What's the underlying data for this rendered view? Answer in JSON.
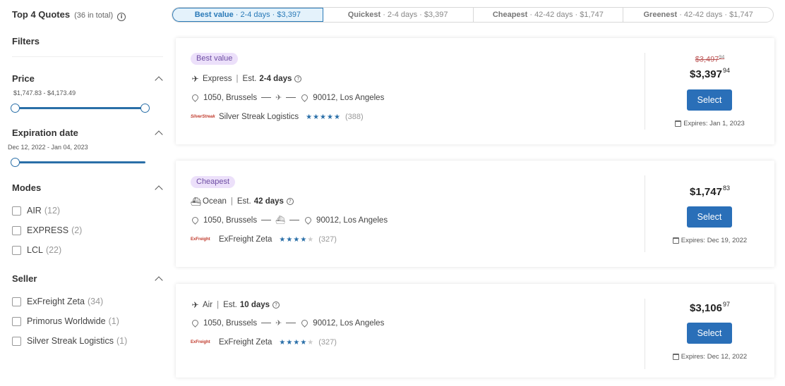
{
  "header": {
    "title": "Top 4 Quotes",
    "count": "(36 in total)"
  },
  "sort_tabs": [
    {
      "label": "Best value",
      "detail": "· 2-4 days · $3,397"
    },
    {
      "label": "Quickest",
      "detail": "· 2-4 days · $3,397"
    },
    {
      "label": "Cheapest",
      "detail": "· 42-42 days · $1,747"
    },
    {
      "label": "Greenest",
      "detail": "· 42-42 days · $1,747"
    }
  ],
  "filters": {
    "title": "Filters",
    "price": {
      "title": "Price",
      "range": "$1,747.83 - $4,173.49"
    },
    "expiration": {
      "title": "Expiration date",
      "range": "Dec 12, 2022 - Jan 04, 2023"
    },
    "modes": {
      "title": "Modes",
      "items": [
        {
          "label": "AIR",
          "count": "(12)"
        },
        {
          "label": "EXPRESS",
          "count": "(2)"
        },
        {
          "label": "LCL",
          "count": "(22)"
        }
      ]
    },
    "seller": {
      "title": "Seller",
      "items": [
        {
          "label": "ExFreight Zeta",
          "count": "(34)"
        },
        {
          "label": "Primorus Worldwide",
          "count": "(1)"
        },
        {
          "label": "Silver Streak Logistics",
          "count": "(1)"
        }
      ]
    }
  },
  "quotes": [
    {
      "badge": "Best value",
      "mode": "Express",
      "est_prefix": "Est.",
      "est_days": "2-4 days",
      "origin": "1050, Brussels",
      "destination": "90012, Los Angeles",
      "logo_text": "SilverStreak",
      "seller": "Silver Streak Logistics",
      "reviews": "(388)",
      "old_price": "$3,497",
      "old_cents": "94",
      "price": "$3,397",
      "cents": "94",
      "select_label": "Select",
      "expires": "Expires: Jan 1, 2023"
    },
    {
      "badge": "Cheapest",
      "mode": "Ocean",
      "est_prefix": "Est.",
      "est_days": "42 days",
      "origin": "1050, Brussels",
      "destination": "90012, Los Angeles",
      "logo_text": "ExFreight",
      "seller": "ExFreight Zeta",
      "reviews": "(327)",
      "price": "$1,747",
      "cents": "83",
      "select_label": "Select",
      "expires": "Expires: Dec 19, 2022"
    },
    {
      "mode": "Air",
      "est_prefix": "Est.",
      "est_days": "10 days",
      "origin": "1050, Brussels",
      "destination": "90012, Los Angeles",
      "logo_text": "ExFreight",
      "seller": "ExFreight Zeta",
      "reviews": "(327)",
      "price": "$3,106",
      "cents": "97",
      "select_label": "Select",
      "expires": "Expires: Dec 12, 2022"
    }
  ],
  "colors": {
    "accent": "#2a6fb8",
    "badge_bg": "#ece0fa",
    "badge_text": "#6d4da3",
    "star": "#2a6fa8"
  }
}
